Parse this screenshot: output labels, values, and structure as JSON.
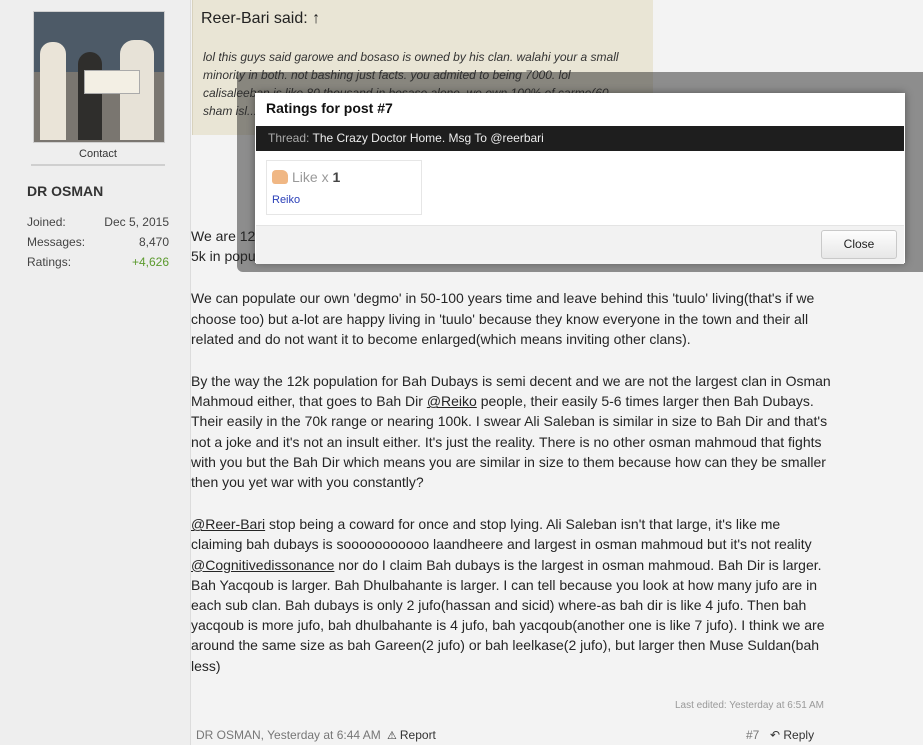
{
  "sidebar": {
    "contact_label": "Contact",
    "username": "DR OSMAN",
    "stats": [
      {
        "label": "Joined:",
        "value": "Dec 5, 2015"
      },
      {
        "label": "Messages:",
        "value": "8,470"
      },
      {
        "label": "Ratings:",
        "value": "+4,626"
      }
    ]
  },
  "quote": {
    "header": "Reer-Bari said: ↑",
    "text": "lol this guys said garowe and bosaso is owned by his clan. walahi your a small minority in both. not bashing just facts. you admited to being 7000. lol calisaleeban is like 80 thousand in bosaso alone. we own 100% of carmo(60 ... sham isl... cognot... walahi..."
  },
  "post": {
    "p1": "We are 12k ... what my e... will be 7k female also. So 12k as a bare minimum. A decent sized 'tuulo' is 5k in population.",
    "p2": "We can populate our own 'degmo' in 50-100 years time and leave behind this 'tuulo' living(that's if we choose too) but a-lot are happy living in 'tuulo' because they know everyone in the town and their all related and do not want it to become enlarged(which means inviting other clans).",
    "p3a": "By the way the 12k population for Bah Dubays is semi decent and we are not the largest clan in Osman Mahmoud either, that goes to Bah Dir ",
    "p3_mention": "@Reiko",
    "p3b": " people, their easily 5-6 times larger then Bah Dubays. Their easily in the 70k range or nearing 100k. I swear Ali Saleban is similar in size to Bah Dir and that's not a joke and it's not an insult either. It's just the reality. There is no other osman mahmoud that fights with you but the Bah Dir which means you are similar in size to them because how can they be smaller then you yet war with you constantly?",
    "p4_mention1": "@Reer-Bari",
    "p4a": " stop being a coward for once and stop lying. Ali Saleban isn't that large, it's like me claiming bah dubays is sooooooooooo laandheere and largest in osman mahmoud but it's not reality ",
    "p4_mention2": "@Cognitivedissonance",
    "p4b": " nor do I claim Bah dubays is the largest in osman mahmoud. Bah Dir is larger. Bah Yacqoub is larger. Bah Dhulbahante is larger. I can tell because you look at how many jufo are in each sub clan. Bah dubays is only 2 jufo(hassan and sicid) where-as bah dir is like 4 jufo. Then bah yacqoub is more jufo, bah dhulbahante is 4 jufo, bah yacqoub(another one is like 7 jufo). I think we are around the same size as bah Gareen(2 jufo) or bah leelkase(2 jufo), but larger then Muse Suldan(bah less)",
    "last_edited": "Last edited: Yesterday at 6:51 AM",
    "author_time": "DR OSMAN, Yesterday at 6:44 AM",
    "report_label": "Report",
    "post_number": "#7",
    "reply_label": "Reply"
  },
  "dialog": {
    "title": "Ratings for post #7",
    "thread_label": "Thread:",
    "thread_title": "The Crazy Doctor Home. Msg To @reerbari",
    "rating_name": "Like x",
    "rating_count": "1",
    "rating_user": "Reiko",
    "close_label": "Close"
  },
  "icons": {
    "report": "warning-icon",
    "reply": "reply-arrow-icon",
    "like": "thumbs-up-icon"
  }
}
